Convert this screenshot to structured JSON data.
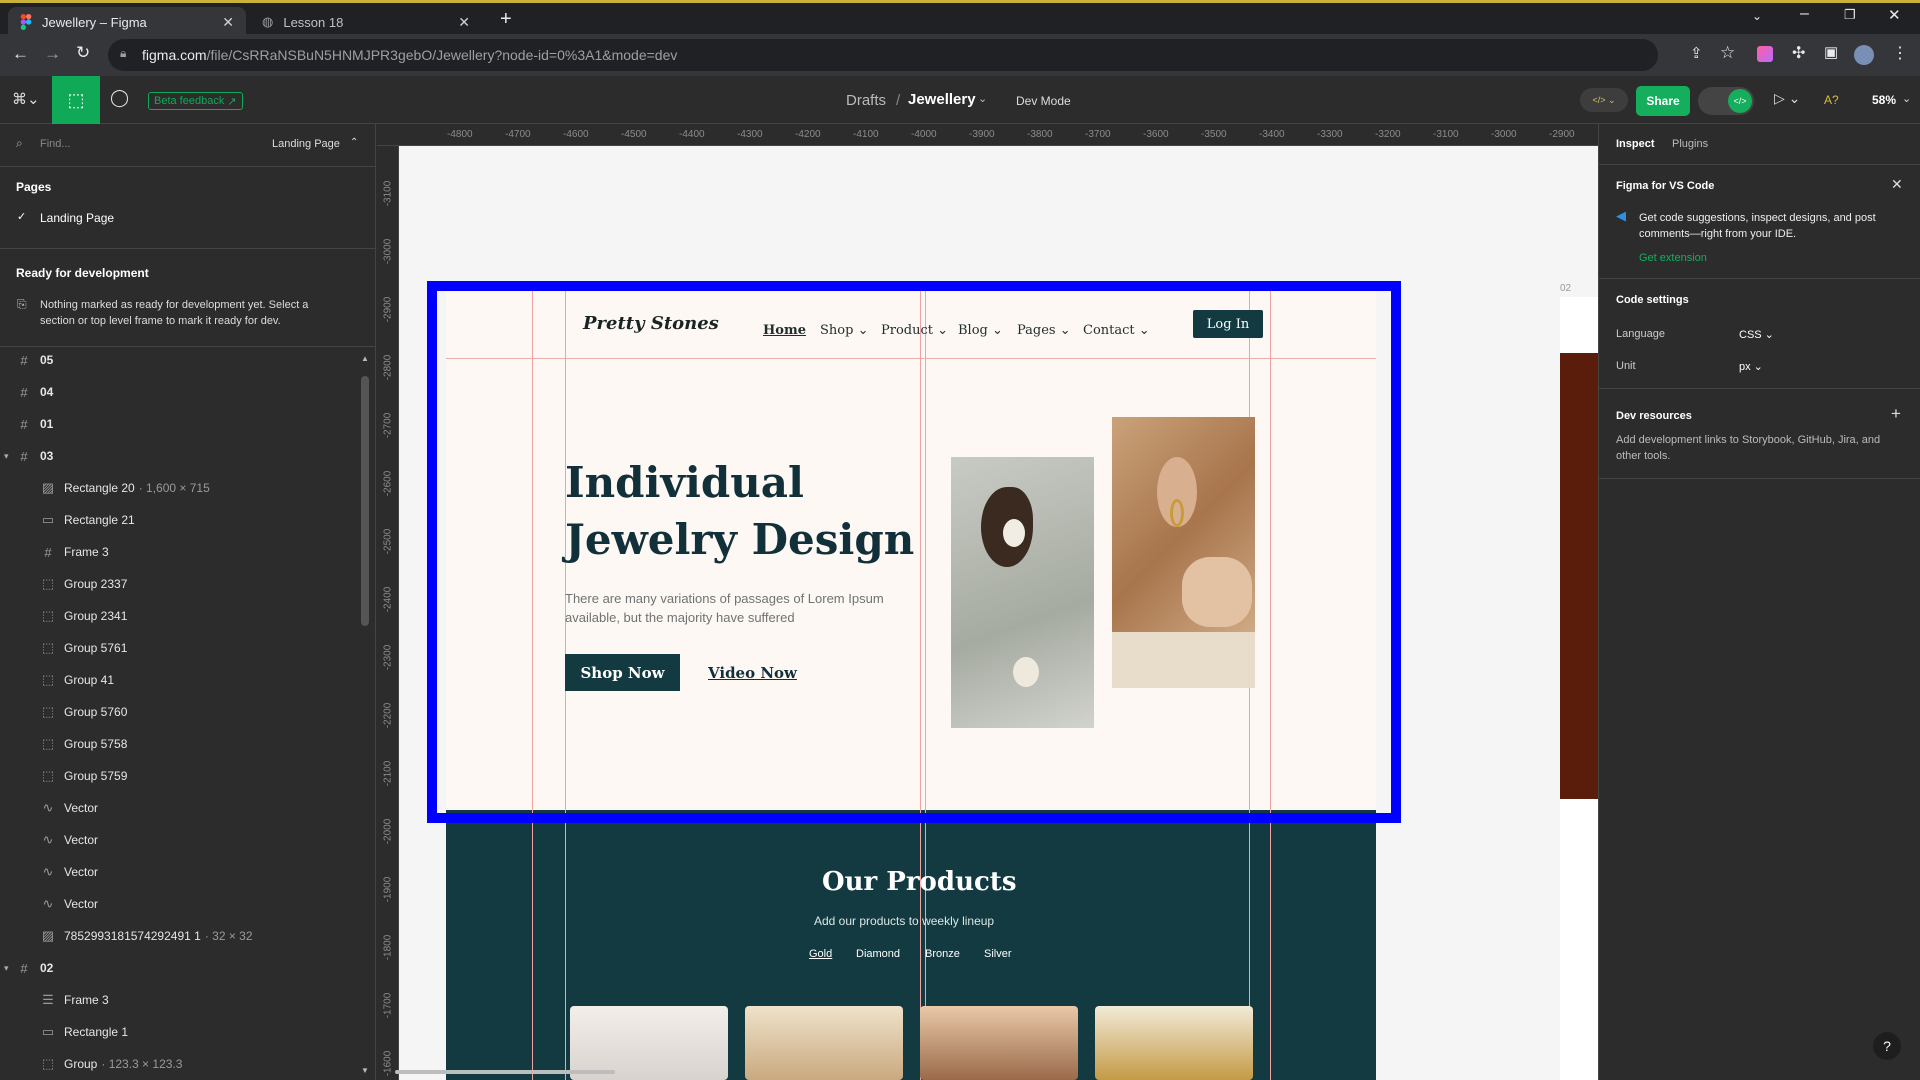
{
  "browser": {
    "tabs": [
      {
        "title": "Jewellery – Figma"
      },
      {
        "title": "Lesson 18"
      }
    ],
    "url_host": "figma.com",
    "url_path": "/file/CsRRaNSBuN5HNMJPR3gebO/Jewellery?node-id=0%3A1&mode=dev"
  },
  "figma_bar": {
    "beta_feedback": "Beta feedback",
    "breadcrumb_drafts": "Drafts",
    "breadcrumb_sep": "/",
    "file_name": "Jewellery",
    "mode_label": "Dev Mode",
    "share_label": "Share",
    "zoom": "58%",
    "missing_fonts": "A?"
  },
  "left_panel": {
    "search_placeholder": "Find...",
    "page_selector": "Landing Page",
    "pages_heading": "Pages",
    "current_page": "Landing Page",
    "ready_heading": "Ready for development",
    "ready_text_1": "Nothing marked as ready for development yet. Select a",
    "ready_text_2": "section or top level frame to mark it ready for dev.",
    "layers": [
      {
        "name": "05",
        "icon": "frame-icon",
        "depth": 0
      },
      {
        "name": "04",
        "icon": "frame-icon",
        "depth": 0
      },
      {
        "name": "01",
        "icon": "frame-icon",
        "depth": 0
      },
      {
        "name": "03",
        "icon": "frame-icon",
        "depth": 0
      },
      {
        "name": "Rectangle 20",
        "dim": "1,600 × 715",
        "icon": "image-icon",
        "depth": 1
      },
      {
        "name": "Rectangle 21",
        "icon": "rectangle-icon",
        "depth": 1
      },
      {
        "name": "Frame 3",
        "icon": "frame-icon",
        "depth": 1
      },
      {
        "name": "Group 2337",
        "icon": "group-icon",
        "depth": 1
      },
      {
        "name": "Group 2341",
        "icon": "group-icon",
        "depth": 1
      },
      {
        "name": "Group 5761",
        "icon": "group-icon",
        "depth": 1
      },
      {
        "name": "Group 41",
        "icon": "group-icon",
        "depth": 1
      },
      {
        "name": "Group 5760",
        "icon": "group-icon",
        "depth": 1
      },
      {
        "name": "Group 5758",
        "icon": "group-icon",
        "depth": 1
      },
      {
        "name": "Group 5759",
        "icon": "group-icon",
        "depth": 1
      },
      {
        "name": "Vector",
        "icon": "vector-icon",
        "depth": 1
      },
      {
        "name": "Vector",
        "icon": "vector-icon",
        "depth": 1
      },
      {
        "name": "Vector",
        "icon": "vector-icon",
        "depth": 1
      },
      {
        "name": "Vector",
        "icon": "vector-icon",
        "depth": 1
      },
      {
        "name": "785299318157429249​1 1",
        "dim": "32 × 32",
        "icon": "image-icon",
        "depth": 1
      },
      {
        "name": "02",
        "icon": "frame-icon",
        "depth": 0
      },
      {
        "name": "Frame 3",
        "icon": "autolayout-icon",
        "depth": 1
      },
      {
        "name": "Rectangle 1",
        "icon": "rectangle-icon",
        "depth": 1
      },
      {
        "name": "Group",
        "dim": "123.3 × 123.3",
        "icon": "group-icon",
        "depth": 1
      }
    ]
  },
  "ruler": {
    "top_ticks": [
      "-4800",
      "-4700",
      "-4600",
      "-4500",
      "-4400",
      "-4300",
      "-4200",
      "-4100",
      "-4000",
      "-3900",
      "-3800",
      "-3700",
      "-3600",
      "-3500",
      "-3400",
      "-3300",
      "-3200",
      "-3100",
      "-3000",
      "-2900"
    ],
    "left_ticks": [
      "-3100",
      "-3000",
      "-2900",
      "-2800",
      "-2700",
      "-2600",
      "-2500",
      "-2400",
      "-2300",
      "-2200",
      "-2100",
      "-2000",
      "-1900",
      "-1800",
      "-1700",
      "-1600"
    ]
  },
  "design": {
    "brand": "Pretty Stones",
    "nav": [
      "Home",
      "Shop",
      "Product",
      "Blog",
      "Pages",
      "Contact"
    ],
    "login": "Log In",
    "hero_title_1": "Individual",
    "hero_title_2": "Jewelry Design",
    "hero_body_1": "There are many variations of passages of Lorem Ipsum",
    "hero_body_2": "available, but the majority have suffered",
    "shop_now": "Shop Now",
    "video_now": "Video Now",
    "products_title": "Our Products",
    "products_sub": "Add our products to weekly lineup",
    "product_tabs": [
      "Gold",
      "Diamond",
      "Bronze",
      "Silver"
    ],
    "frame_label": "02"
  },
  "right_panel": {
    "tab_inspect": "Inspect",
    "tab_plugins": "Plugins",
    "vscode_title": "Figma for VS Code",
    "vscode_text_1": "Get code suggestions, inspect designs, and post",
    "vscode_text_2": "comments—right from your IDE.",
    "get_extension": "Get extension",
    "code_settings": "Code settings",
    "language_label": "Language",
    "language_value": "CSS",
    "unit_label": "Unit",
    "unit_value": "px",
    "dev_resources": "Dev resources",
    "dev_text_1": "Add development links to Storybook, GitHub, Jira, and",
    "dev_text_2": "other tools."
  },
  "colors": {
    "selection": "#0000ff",
    "dark_teal": "#123a40",
    "share_green": "#14ae5c",
    "cream": "#fdf8f3"
  }
}
